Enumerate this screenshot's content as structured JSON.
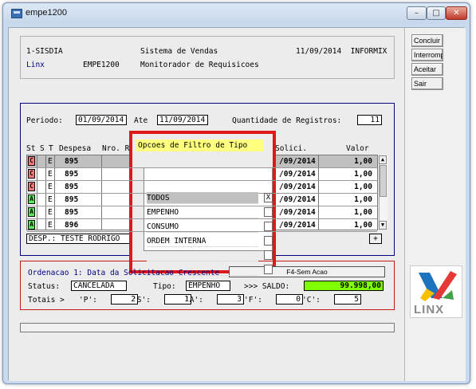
{
  "window": {
    "title": "empe1200"
  },
  "header": {
    "line1_left": "1-SISDIA",
    "line1_center": "Sistema de Vendas",
    "line1_right": "11/09/2014  INFORMIX",
    "line2_left": "Linx",
    "line2_mid": "EMPE1200",
    "line2_center": "Monitorador de Requisicoes"
  },
  "sidebar": {
    "buttons": [
      "Concluir",
      "Interromper",
      "Aceitar",
      "Sair"
    ]
  },
  "filters": {
    "periodo_label": "Periodo:",
    "periodo_from": "01/09/2014",
    "ate_label": "Ate",
    "periodo_to": "11/09/2014",
    "qtd_label": "Quantidade de Registros:",
    "qtd_value": "11"
  },
  "table": {
    "headers": {
      "st": "St",
      "s": "S",
      "t": "T",
      "despesa": "Despesa",
      "nro": "Nro. R",
      "solici": "Solici.",
      "valor": "Valor"
    },
    "rows": [
      {
        "st": "C",
        "st_color": "#ff7b7b",
        "t": "E",
        "despesa": "895",
        "solici": "/09/2014",
        "valor": "1,00"
      },
      {
        "st": "C",
        "st_color": "#ff7b7b",
        "t": "E",
        "despesa": "895",
        "solici": "/09/2014",
        "valor": "1,00"
      },
      {
        "st": "C",
        "st_color": "#ff7b7b",
        "t": "E",
        "despesa": "895",
        "solici": "/09/2014",
        "valor": "1,00"
      },
      {
        "st": "A",
        "st_color": "#55ee55",
        "t": "E",
        "despesa": "895",
        "solici": "/09/2014",
        "valor": "1,00"
      },
      {
        "st": "A",
        "st_color": "#55ee55",
        "t": "E",
        "despesa": "895",
        "solici": "/09/2014",
        "valor": "1,00"
      },
      {
        "st": "A",
        "st_color": "#55ee55",
        "t": "E",
        "despesa": "896",
        "solici": "/09/2014",
        "valor": "1,00"
      }
    ],
    "desp_text": "DESP.: TESTE RODRIGO",
    "plus": "+"
  },
  "popup": {
    "title": "Opcoes de Filtro de Tipo",
    "options": [
      {
        "label": "TODOS",
        "mark": "X"
      },
      {
        "label": "EMPENHO",
        "mark": ""
      },
      {
        "label": "CONSUMO",
        "mark": ""
      },
      {
        "label": "ORDEM INTERNA",
        "mark": ""
      },
      {
        "label": "",
        "mark": ""
      },
      {
        "label": "",
        "mark": ""
      }
    ]
  },
  "status": {
    "ordenacao": "Ordenacao 1: Data da Solicitacao Crescente",
    "f4_button": "F4-Sem Acao",
    "status_label": "Status:",
    "status_value": "CANCELADA",
    "tipo_label": "Tipo:",
    "tipo_value": "EMPENHO",
    "saldo_label": ">>> SALDO:",
    "saldo_value": "99.998,00",
    "totais_label": "Totais >",
    "totals": [
      {
        "k": "'P':",
        "v": "2"
      },
      {
        "k": "'S':",
        "v": "1"
      },
      {
        "k": "'A':",
        "v": "3"
      },
      {
        "k": "'F':",
        "v": "0"
      },
      {
        "k": "'C':",
        "v": "5"
      }
    ]
  },
  "logo": {
    "text": "LINX"
  }
}
